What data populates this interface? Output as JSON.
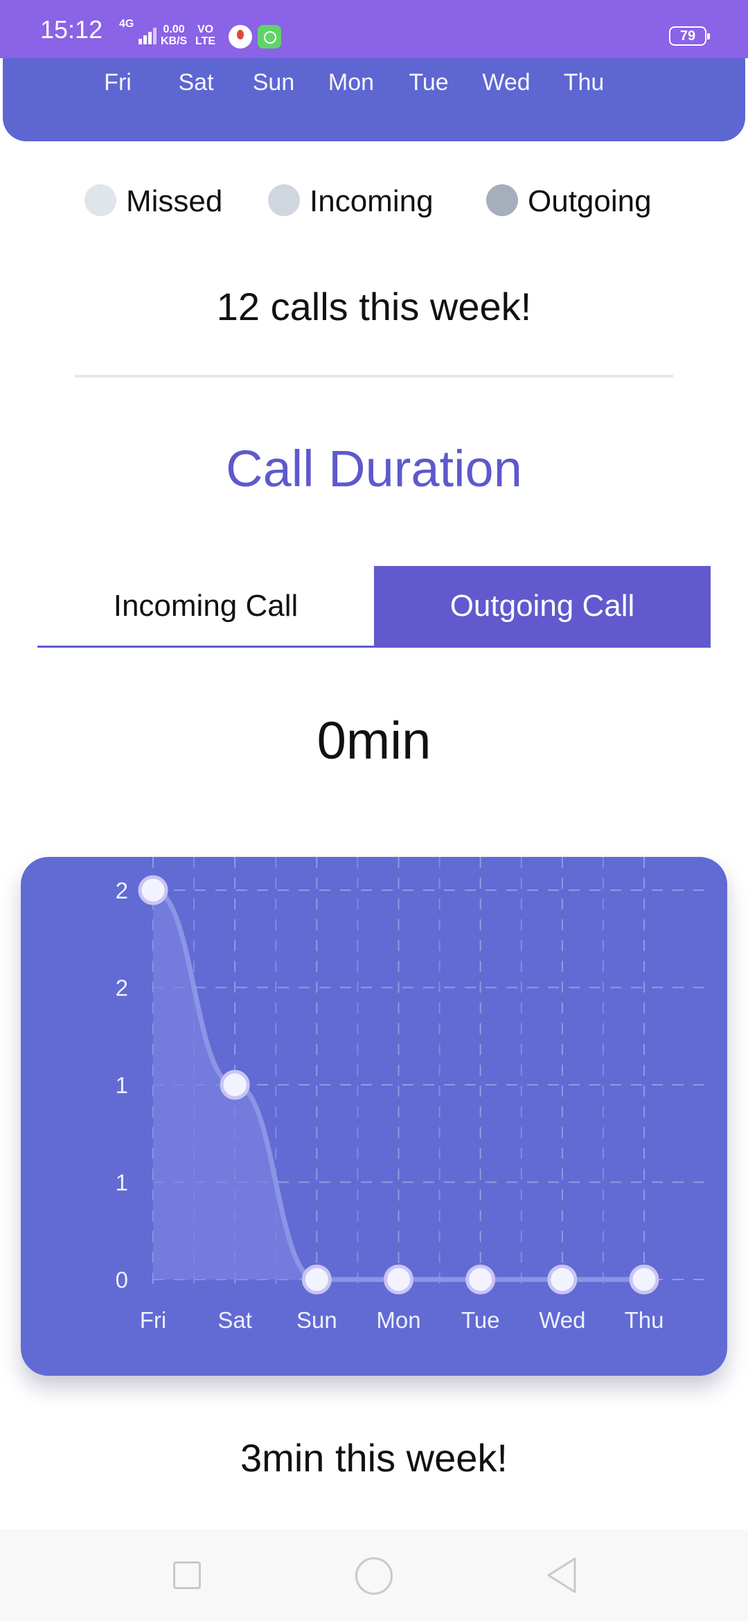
{
  "status_bar": {
    "time": "15:12",
    "network": "4G",
    "speed_value": "0.00",
    "speed_unit": "KB/S",
    "volte_top": "VO",
    "volte_bottom": "LTE",
    "battery": "79"
  },
  "week_days": [
    "Fri",
    "Sat",
    "Sun",
    "Mon",
    "Tue",
    "Wed",
    "Thu"
  ],
  "legend": [
    {
      "label": "Missed",
      "color": "#E0E4EB"
    },
    {
      "label": "Incoming",
      "color": "#D0D6DF"
    },
    {
      "label": "Outgoing",
      "color": "#A5AFBB"
    }
  ],
  "calls_summary": "12 calls this week!",
  "section_title": "Call Duration",
  "tabs": {
    "incoming": "Incoming Call",
    "outgoing": "Outgoing Call",
    "selected": "outgoing"
  },
  "duration_value": "0min",
  "chart_data": {
    "type": "line",
    "categories": [
      "Fri",
      "Sat",
      "Sun",
      "Mon",
      "Tue",
      "Wed",
      "Thu"
    ],
    "series": [
      {
        "values": [
          2,
          1,
          0,
          0,
          0,
          0,
          0
        ]
      }
    ],
    "y_tick_values": [
      0,
      0.5,
      1,
      1.5,
      2
    ],
    "y_tick_labels": [
      "0",
      "1",
      "1",
      "2",
      "2"
    ],
    "ylim": [
      0,
      2
    ],
    "grid": true,
    "smooth": true,
    "area_fill": true,
    "colors": {
      "background": "#616BD3",
      "line": "#8C94E6",
      "fill": "#7A82E0",
      "point": "#F3F3FF"
    }
  },
  "weekly_total": "3min this week!",
  "theme": {
    "accent": "#5E66D2",
    "status_bar": "#8A63E6",
    "title": "#5D59CC"
  }
}
